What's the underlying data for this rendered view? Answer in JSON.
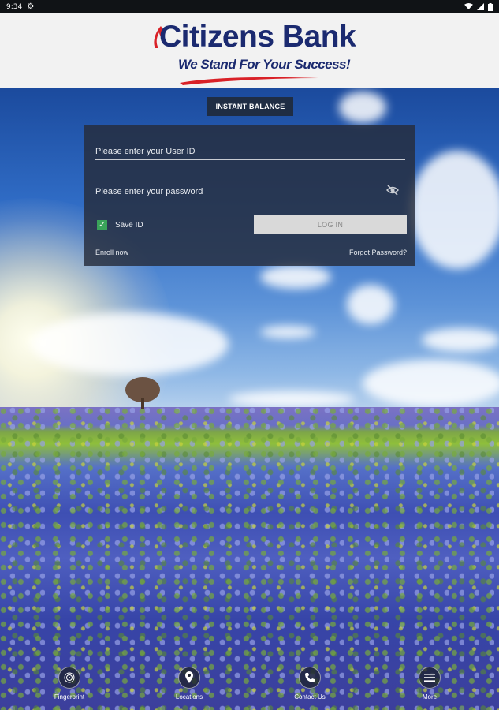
{
  "status_bar": {
    "time": "9:34"
  },
  "header": {
    "bank_name": "Citizens Bank",
    "tagline": "We Stand For Your Success!",
    "colors": {
      "brand_blue": "#1b2a70",
      "accent_red": "#d92127"
    }
  },
  "instant_balance": {
    "label": "INSTANT BALANCE"
  },
  "login": {
    "user_id_placeholder": "Please enter your User ID",
    "password_placeholder": "Please enter your password",
    "save_id_label": "Save ID",
    "save_id_checked": true,
    "login_label": "LOG IN",
    "enroll_label": "Enroll now",
    "forgot_label": "Forgot Password?"
  },
  "bottom_nav": {
    "items": [
      {
        "label": "Fingerprint",
        "icon": "fingerprint-icon"
      },
      {
        "label": "Locations",
        "icon": "location-pin-icon"
      },
      {
        "label": "Contact Us",
        "icon": "phone-icon"
      },
      {
        "label": "More",
        "icon": "menu-icon"
      }
    ]
  }
}
